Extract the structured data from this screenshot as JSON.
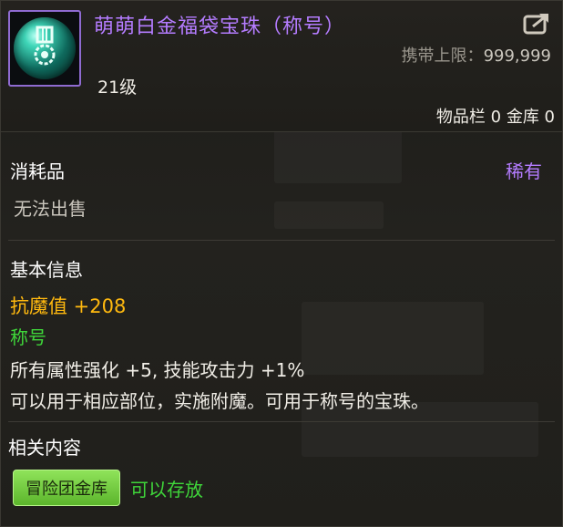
{
  "item": {
    "name": "萌萌白金福袋宝珠（称号）",
    "carry_limit_label": "携带上限：",
    "carry_limit_value": "999,999",
    "level": "21级",
    "storage_text": "物品栏 0 金库 0",
    "type": "消耗品",
    "rarity": "稀有",
    "sell_status": "无法出售"
  },
  "basic_info": {
    "title": "基本信息",
    "main_stat": "抗魔值 +208",
    "tag": "称号",
    "lines": [
      "所有属性强化 +5, 技能攻击力 +1%",
      "可以用于相应部位，实施附魔。可用于称号的宝珠。"
    ]
  },
  "related": {
    "title": "相关内容",
    "vault_button": "冒险团金库",
    "vault_status": "可以存放"
  },
  "colors": {
    "name_purple": "#b47cff",
    "stat_gold": "#ffb90f",
    "tag_green": "#3fd63a",
    "button_green": "#7acb45"
  },
  "icons": {
    "item": "emerald-orb-medal-icon",
    "share": "share-arrow-icon"
  }
}
